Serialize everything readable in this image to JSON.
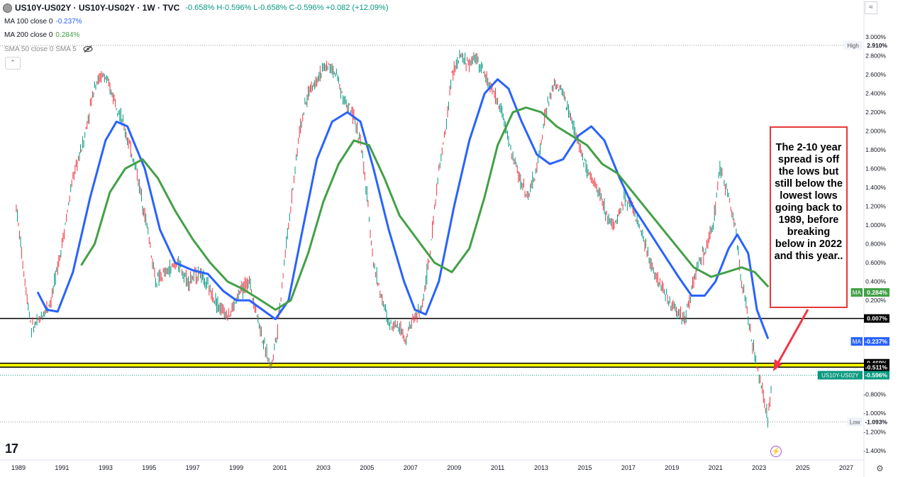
{
  "header": {
    "symbol": "US10Y-US02Y · US10Y-US02Y · 1W · TVC",
    "ohlc": "-0.658% H-0.596% L-0.658% C-0.596% +0.082 (+12.09%)"
  },
  "indicators": [
    {
      "label": "MA 100 close 0",
      "value": "-0.237%",
      "color": "#2962ff"
    },
    {
      "label": "MA 200 close 0",
      "value": "0.284%",
      "color": "#43a047"
    },
    {
      "label": "SMA 50 close 0 SMA 5",
      "value": "",
      "color": "#8e8e8e"
    }
  ],
  "icons": {
    "visibility": "eye-off-icon",
    "collapse": "chevron-up-icon",
    "bolt": "lightning-icon",
    "settings": "gear-icon",
    "logo": "tradingview-logo"
  },
  "annotation": {
    "text": "The 2-10 year spread is off the lows but still below the lowest lows going back to 1989, before breaking below in 2022 and this year.."
  },
  "logo_text": "17",
  "price_axis_labels": [
    {
      "label": "3.000%",
      "value": 3.0
    },
    {
      "label": "2.800%",
      "value": 2.8
    },
    {
      "label": "2.600%",
      "value": 2.6
    },
    {
      "label": "2.400%",
      "value": 2.4
    },
    {
      "label": "2.200%",
      "value": 2.2
    },
    {
      "label": "2.000%",
      "value": 2.0
    },
    {
      "label": "1.800%",
      "value": 1.8
    },
    {
      "label": "1.600%",
      "value": 1.6
    },
    {
      "label": "1.400%",
      "value": 1.4
    },
    {
      "label": "1.200%",
      "value": 1.2
    },
    {
      "label": "1.000%",
      "value": 1.0
    },
    {
      "label": "0.800%",
      "value": 0.8
    },
    {
      "label": "0.600%",
      "value": 0.6
    },
    {
      "label": "0.400%",
      "value": 0.4
    },
    {
      "label": "0.200%",
      "value": 0.2
    },
    {
      "label": "-0.800%",
      "value": -0.8
    },
    {
      "label": "-1.000%",
      "value": -1.0
    },
    {
      "label": "-1.200%",
      "value": -1.2
    },
    {
      "label": "-1.400%",
      "value": -1.4
    }
  ],
  "tags": [
    {
      "text": "2.910%",
      "prefix": "High",
      "value": 2.91,
      "kind": "plain"
    },
    {
      "text": "0.284%",
      "prefix": "MA",
      "value": 0.284,
      "kind": "green"
    },
    {
      "text": "0.007%",
      "prefix": "",
      "value": 0.007,
      "kind": "black"
    },
    {
      "text": "-0.237%",
      "prefix": "MA",
      "value": -0.237,
      "kind": "blue"
    },
    {
      "text": "-0.469%",
      "prefix": "",
      "value": -0.469,
      "kind": "black"
    },
    {
      "text": "-0.511%",
      "prefix": "",
      "value": -0.511,
      "kind": "black"
    },
    {
      "text": "-0.596%",
      "prefix": "US10Y-US02Y",
      "value": -0.596,
      "kind": "green"
    },
    {
      "text": "-1.093%",
      "prefix": "Low",
      "value": -1.093,
      "kind": "plain"
    }
  ],
  "chart_data": {
    "type": "line",
    "title": "US10Y-US02Y · US10Y-US02Y · 1W · TVC",
    "xlabel": "",
    "ylabel": "",
    "x_ticks": [
      "1989",
      "1991",
      "1993",
      "1995",
      "1997",
      "1999",
      "2001",
      "2003",
      "2005",
      "2007",
      "2009",
      "2011",
      "2013",
      "2015",
      "2017",
      "2019",
      "2021",
      "2023",
      "2025",
      "2027"
    ],
    "xlim": [
      1988.8,
      2028.2
    ],
    "ylim": [
      -1.45,
      3.05
    ],
    "horizontal_lines": [
      {
        "value": 0.007,
        "color": "#000000"
      },
      {
        "value": -0.469,
        "color": "#000000"
      },
      {
        "value": -0.511,
        "color": "#000000"
      }
    ],
    "zone": {
      "from": -0.511,
      "to": -0.469,
      "color": "#ffff00"
    },
    "series": [
      {
        "name": "US10Y-US02Y",
        "color": "#089981",
        "x": [
          1988.9,
          1989.3,
          1989.6,
          1990.0,
          1990.5,
          1991.0,
          1991.5,
          1992.0,
          1992.5,
          1992.9,
          1993.5,
          1993.9,
          1994.4,
          1994.9,
          1995.3,
          1995.8,
          1996.3,
          1996.8,
          1997.3,
          1997.8,
          1998.3,
          1998.7,
          1999.2,
          1999.6,
          2000.0,
          2000.3,
          2000.6,
          2000.9,
          2001.2,
          2001.6,
          2001.9,
          2002.3,
          2002.8,
          2003.2,
          2003.6,
          2004.0,
          2004.3,
          2004.7,
          2005.0,
          2005.3,
          2005.7,
          2006.0,
          2006.4,
          2006.8,
          2007.1,
          2007.5,
          2007.9,
          2008.2,
          2008.6,
          2008.9,
          2009.3,
          2009.7,
          2010.0,
          2010.4,
          2010.8,
          2011.2,
          2011.6,
          2012.0,
          2012.4,
          2012.8,
          2013.2,
          2013.6,
          2014.0,
          2014.4,
          2014.8,
          2015.2,
          2015.6,
          2016.0,
          2016.4,
          2016.8,
          2017.2,
          2017.6,
          2018.0,
          2018.4,
          2018.8,
          2019.2,
          2019.6,
          2019.9,
          2020.2,
          2020.5,
          2020.9,
          2021.2,
          2021.6,
          2021.9,
          2022.2,
          2022.5,
          2022.8,
          2023.0,
          2023.2,
          2023.4,
          2023.6
        ],
        "values": [
          1.2,
          0.4,
          -0.1,
          0.0,
          0.2,
          0.8,
          1.5,
          1.9,
          2.5,
          2.6,
          2.3,
          2.0,
          1.6,
          1.0,
          0.4,
          0.5,
          0.6,
          0.4,
          0.5,
          0.3,
          0.1,
          0.05,
          0.3,
          0.4,
          0.0,
          -0.3,
          -0.5,
          -0.1,
          0.6,
          1.4,
          2.0,
          2.4,
          2.6,
          2.7,
          2.6,
          2.3,
          2.2,
          1.9,
          1.3,
          0.6,
          0.2,
          -0.05,
          -0.05,
          -0.2,
          0.0,
          0.1,
          0.7,
          1.4,
          2.0,
          2.6,
          2.8,
          2.7,
          2.8,
          2.6,
          2.4,
          2.2,
          1.8,
          1.5,
          1.3,
          1.6,
          2.2,
          2.5,
          2.4,
          2.1,
          1.8,
          1.5,
          1.4,
          1.1,
          1.0,
          1.3,
          1.2,
          0.9,
          0.6,
          0.4,
          0.2,
          0.1,
          0.0,
          0.3,
          0.6,
          0.7,
          1.0,
          1.6,
          1.3,
          1.0,
          0.4,
          0.0,
          -0.4,
          -0.6,
          -0.8,
          -1.09,
          -0.6
        ]
      },
      {
        "name": "MA 100 close 0",
        "color": "#2962ff",
        "x": [
          1989.9,
          1990.3,
          1990.8,
          1991.5,
          1992.3,
          1993.0,
          1993.5,
          1994.0,
          1994.8,
          1995.5,
          1996.2,
          1997.0,
          1997.7,
          1998.4,
          1999.0,
          1999.6,
          2000.2,
          2000.8,
          2001.4,
          2002.0,
          2002.7,
          2003.4,
          2004.1,
          2004.7,
          2005.3,
          2006.0,
          2006.7,
          2007.2,
          2007.7,
          2008.3,
          2009.0,
          2009.7,
          2010.4,
          2011.0,
          2011.5,
          2012.1,
          2012.8,
          2013.4,
          2014.0,
          2014.7,
          2015.3,
          2015.9,
          2016.6,
          2017.2,
          2017.9,
          2018.6,
          2019.3,
          2019.9,
          2020.5,
          2021.0,
          2021.6,
          2022.0,
          2022.5,
          2022.9,
          2023.4
        ],
        "values": [
          0.28,
          0.1,
          0.08,
          0.5,
          1.3,
          1.9,
          2.1,
          2.05,
          1.6,
          0.95,
          0.6,
          0.52,
          0.48,
          0.3,
          0.2,
          0.2,
          0.1,
          0.0,
          0.2,
          0.9,
          1.7,
          2.1,
          2.2,
          2.1,
          1.6,
          0.95,
          0.4,
          0.1,
          0.05,
          0.4,
          1.2,
          1.9,
          2.4,
          2.55,
          2.45,
          2.1,
          1.75,
          1.65,
          1.7,
          1.95,
          2.05,
          1.9,
          1.5,
          1.2,
          0.95,
          0.7,
          0.45,
          0.25,
          0.25,
          0.4,
          0.75,
          0.9,
          0.7,
          0.1,
          -0.2
        ]
      },
      {
        "name": "MA 200 close 0",
        "color": "#43a047",
        "x": [
          1991.9,
          1992.5,
          1993.2,
          1993.9,
          1994.7,
          1995.4,
          1996.2,
          1997.0,
          1997.8,
          1998.6,
          1999.3,
          2000.0,
          2000.8,
          2001.5,
          2002.3,
          2003.0,
          2003.7,
          2004.4,
          2005.1,
          2005.8,
          2006.5,
          2007.3,
          2008.1,
          2008.9,
          2009.7,
          2010.4,
          2011.0,
          2011.7,
          2012.3,
          2013.0,
          2013.7,
          2014.4,
          2015.1,
          2015.8,
          2016.5,
          2017.2,
          2017.9,
          2018.6,
          2019.3,
          2020.0,
          2020.8,
          2021.5,
          2022.2,
          2022.8,
          2023.4
        ],
        "values": [
          0.58,
          0.8,
          1.35,
          1.6,
          1.7,
          1.5,
          1.15,
          0.85,
          0.6,
          0.4,
          0.32,
          0.22,
          0.1,
          0.2,
          0.7,
          1.25,
          1.65,
          1.9,
          1.85,
          1.5,
          1.1,
          0.85,
          0.6,
          0.5,
          0.75,
          1.3,
          1.85,
          2.2,
          2.25,
          2.2,
          2.05,
          1.95,
          1.85,
          1.65,
          1.55,
          1.35,
          1.15,
          0.95,
          0.75,
          0.55,
          0.45,
          0.5,
          0.55,
          0.5,
          0.35
        ]
      }
    ]
  }
}
